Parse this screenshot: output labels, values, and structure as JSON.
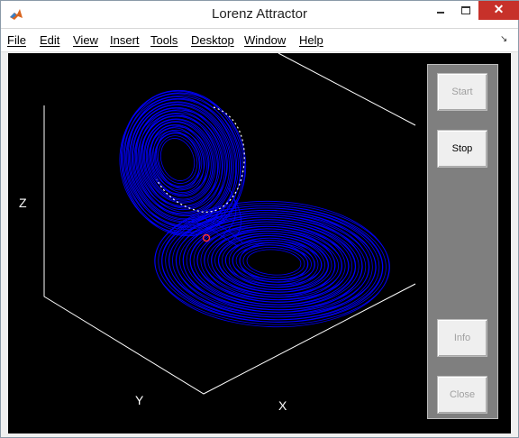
{
  "window": {
    "title": "Lorenz Attractor",
    "minimize_icon": "minimize-icon",
    "maximize_icon": "maximize-icon",
    "close_icon": "close-icon",
    "close_glyph": "✕",
    "close_color": "#c7312a",
    "app_icon": "matlab-logo-icon"
  },
  "menubar": {
    "items": [
      "File",
      "Edit",
      "View",
      "Insert",
      "Tools",
      "Desktop",
      "Window",
      "Help"
    ],
    "dock_icon": "dock-arrow-icon",
    "dock_glyph": "↘"
  },
  "axes": {
    "x_label": "X",
    "y_label": "Y",
    "z_label": "Z",
    "background": "#000000",
    "trajectory_color": "#0000ff",
    "head_color": "#ff0000"
  },
  "controls": {
    "start_label": "Start",
    "stop_label": "Stop",
    "info_label": "Info",
    "close_label": "Close",
    "panel_color": "#7f7f7f"
  }
}
